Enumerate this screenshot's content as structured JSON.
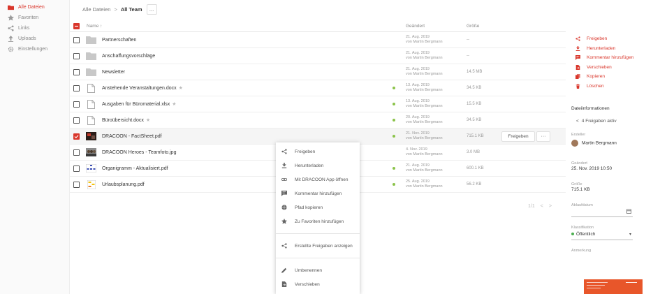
{
  "sidebar": {
    "items": [
      {
        "label": "Alle Dateien",
        "icon": "folder-icon",
        "active": true
      },
      {
        "label": "Favoriten",
        "icon": "star-icon",
        "active": false
      },
      {
        "label": "Links",
        "icon": "share-icon",
        "active": false
      },
      {
        "label": "Uploads",
        "icon": "upload-icon",
        "active": false
      },
      {
        "label": "Einstellungen",
        "icon": "gear-icon",
        "active": false
      }
    ]
  },
  "breadcrumb": {
    "root": "Alle Dateien",
    "separator": ">",
    "current": "All Team",
    "more": "..."
  },
  "table": {
    "headers": {
      "name": "Name",
      "modified": "Geändert",
      "size": "Größe"
    },
    "rows": [
      {
        "name": "Partnerschaften",
        "type": "folder",
        "starred": false,
        "synced": false,
        "date": "21. Aug. 2019",
        "by": "von Martin Bergmann",
        "size": "--",
        "checked": false
      },
      {
        "name": "Anschaffungsvorschläge",
        "type": "folder",
        "starred": false,
        "synced": false,
        "date": "21. Aug. 2019",
        "by": "von Martin Bergmann",
        "size": "--",
        "checked": false
      },
      {
        "name": "Newsletter",
        "type": "folder",
        "starred": false,
        "synced": false,
        "date": "21. Aug. 2019",
        "by": "von Martin Bergmann",
        "size": "14.5 MB",
        "checked": false
      },
      {
        "name": "Anstehende Veranstaltungen.docx",
        "type": "file",
        "starred": true,
        "synced": true,
        "date": "13. Aug. 2019",
        "by": "von Martin Bergmann",
        "size": "34.5 KB",
        "checked": false
      },
      {
        "name": "Ausgaben für Büromaterial.xlsx",
        "type": "file",
        "starred": true,
        "synced": true,
        "date": "13. Aug. 2019",
        "by": "von Martin Bergmann",
        "size": "15.5 KB",
        "checked": false
      },
      {
        "name": "Büroübersicht.docx",
        "type": "file",
        "starred": true,
        "synced": true,
        "date": "20. Aug. 2019",
        "by": "von Martin Bergmann",
        "size": "34.5 KB",
        "checked": false
      },
      {
        "name": "DRACOON - FactSheet.pdf",
        "type": "image-dark",
        "starred": false,
        "synced": true,
        "date": "21. Nov. 2019",
        "by": "von Martin Bergmann",
        "size": "715.1 KB",
        "checked": true
      },
      {
        "name": "DRACOON Heroes - Teamfoto.jpg",
        "type": "image-photo",
        "starred": false,
        "synced": false,
        "date": "4. Nov. 2019",
        "by": "von Martin Bergmann",
        "size": "3.0 MB",
        "checked": false
      },
      {
        "name": "Organigramm - Aktualisiert.pdf",
        "type": "image-diagram",
        "starred": false,
        "synced": true,
        "date": "21. Aug. 2019",
        "by": "von Martin Bergmann",
        "size": "600.1 KB",
        "checked": false
      },
      {
        "name": "Urlaubsplanung.pdf",
        "type": "image-sheet",
        "starred": false,
        "synced": true,
        "date": "25. Aug. 2019",
        "by": "von Martin Bergmann",
        "size": "56.2 KB",
        "checked": false
      }
    ],
    "row_share_label": "Freigeben",
    "row_more_label": "···"
  },
  "pager": {
    "label": "1/1",
    "prev": "<",
    "next": ">"
  },
  "context_menu": {
    "group1": [
      {
        "label": "Freigeben",
        "icon": "share-icon"
      },
      {
        "label": "Herunterladen",
        "icon": "download-icon"
      },
      {
        "label": "Mit DRACOON App öffnen",
        "icon": "link-icon"
      },
      {
        "label": "Kommentar hinzufügen",
        "icon": "comment-icon"
      },
      {
        "label": "Pfad kopieren",
        "icon": "globe-icon"
      },
      {
        "label": "Zu Favoriten hinzufügen",
        "icon": "star-icon"
      }
    ],
    "group2": [
      {
        "label": "Erstellte Freigaben anzeigen",
        "icon": "share-icon"
      }
    ],
    "group3": [
      {
        "label": "Umbenennen",
        "icon": "pencil-icon"
      },
      {
        "label": "Verschieben",
        "icon": "move-icon"
      },
      {
        "label": "Kopieren",
        "icon": "copy-icon"
      }
    ]
  },
  "details_panel": {
    "actions": [
      {
        "label": "Freigeben",
        "icon": "share-icon"
      },
      {
        "label": "Herunterladen",
        "icon": "download-icon"
      },
      {
        "label": "Kommentar hinzufügen",
        "icon": "comment-icon"
      },
      {
        "label": "Verschieben",
        "icon": "move-icon"
      },
      {
        "label": "Kopieren",
        "icon": "copy-icon"
      },
      {
        "label": "Löschen",
        "icon": "trash-icon"
      }
    ],
    "info_title": "Dateiinformationen",
    "shares_active": "4 Freigaben aktiv",
    "creator_label": "Ersteller",
    "creator_name": "Martin Bergmann",
    "modified_label": "Geändert",
    "modified_value": "25. Nov. 2019 10:50",
    "size_label": "Größe",
    "size_value": "715.1 KB",
    "expiry_label": "Ablaufdatum",
    "classification_label": "Klassifikation",
    "classification_value": "Öffentlich",
    "note_label": "Anmerkung"
  },
  "colors": {
    "accent": "#d9362b",
    "fab": "#e8562a",
    "sync_dot": "#8bc34a"
  }
}
